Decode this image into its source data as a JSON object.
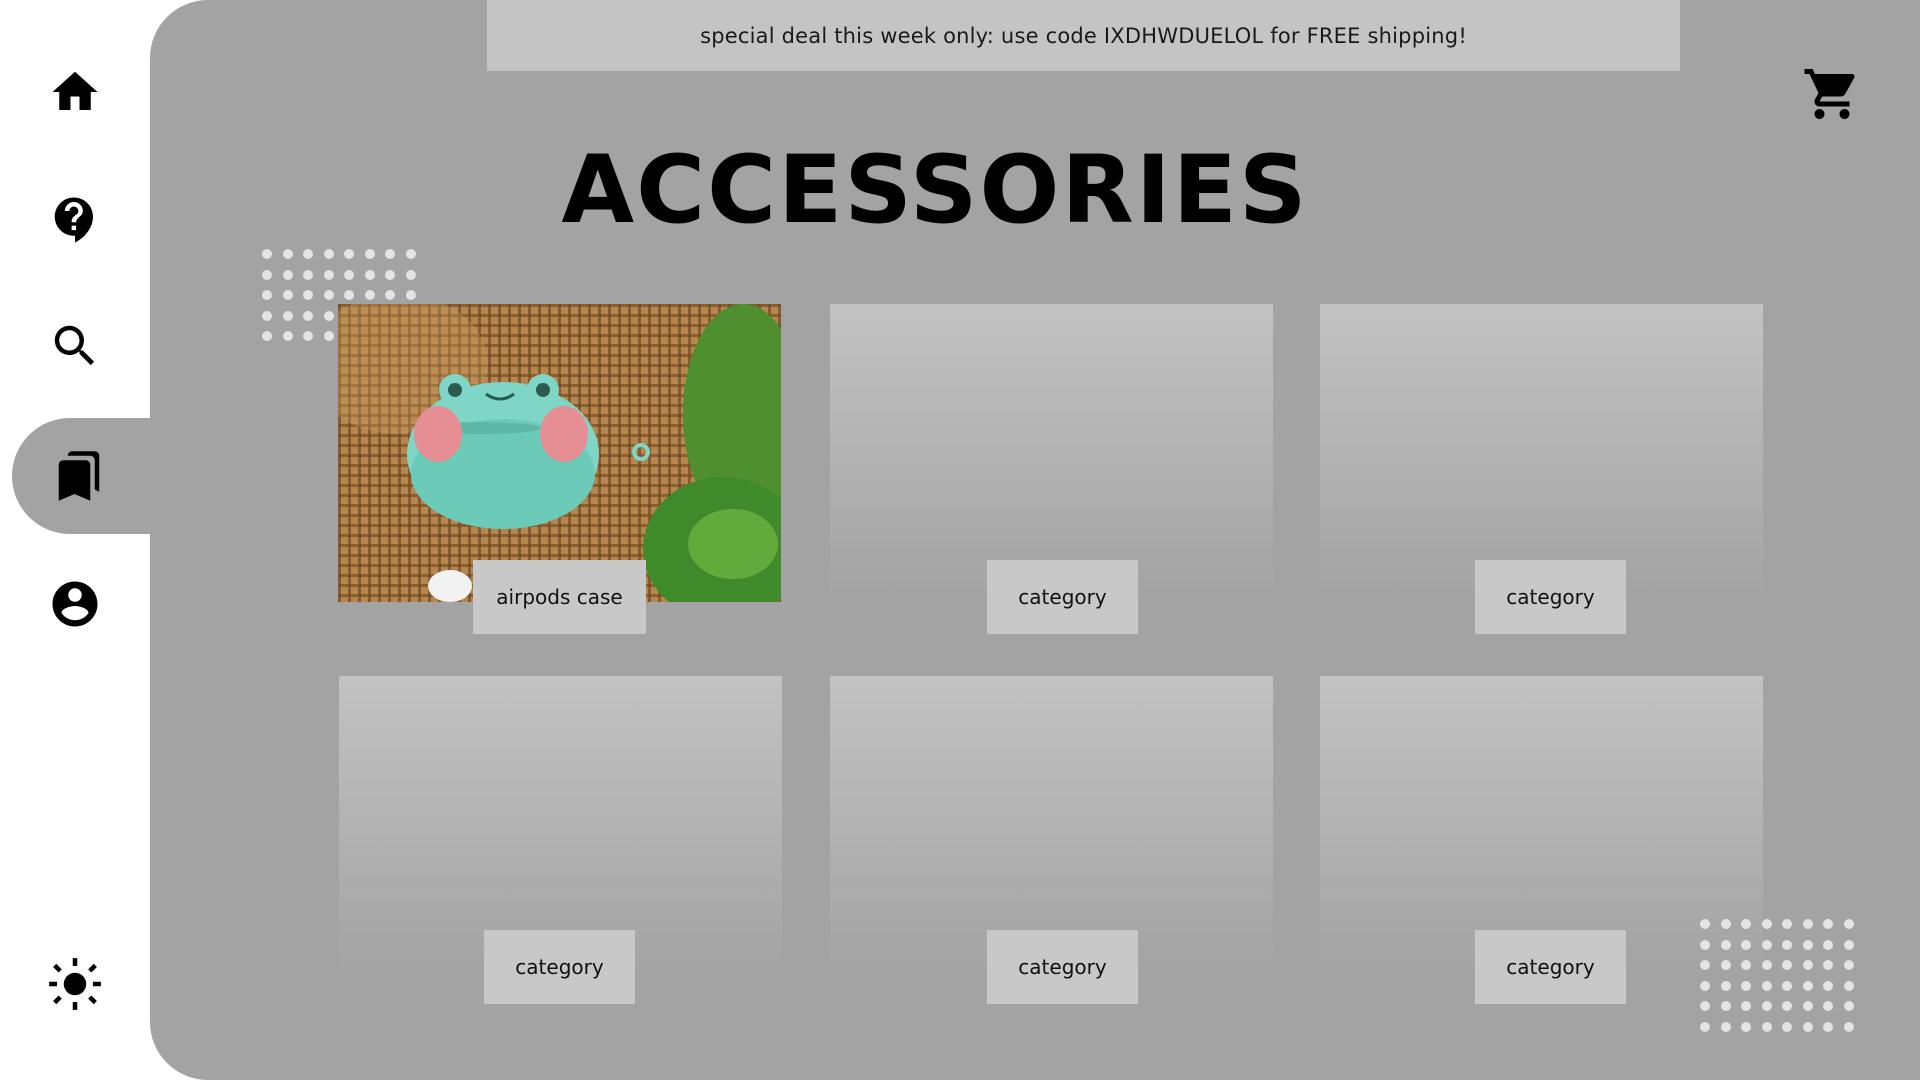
{
  "promo_banner": "special deal this week only: use code IXDHWDUELOL for FREE shipping!",
  "page_title": "ACCESSORIES",
  "sidebar": {
    "items": [
      {
        "icon": "home-icon",
        "active": false
      },
      {
        "icon": "help-icon",
        "active": false
      },
      {
        "icon": "search-icon",
        "active": false
      },
      {
        "icon": "bookmarks-icon",
        "active": true
      },
      {
        "icon": "account-icon",
        "active": false
      },
      {
        "icon": "sun-icon",
        "active": false
      }
    ]
  },
  "header": {
    "cart_icon": "cart-icon"
  },
  "products": [
    {
      "label": "airpods case",
      "has_image": true
    },
    {
      "label": "category",
      "has_image": false
    },
    {
      "label": "category",
      "has_image": false
    },
    {
      "label": "category",
      "has_image": false
    },
    {
      "label": "category",
      "has_image": false
    },
    {
      "label": "category",
      "has_image": false
    }
  ],
  "colors": {
    "main_bg": "#a3a3a3",
    "banner_bg": "#c4c4c4",
    "label_bg": "#c8c8c8",
    "sidebar_bg": "#ffffff"
  }
}
